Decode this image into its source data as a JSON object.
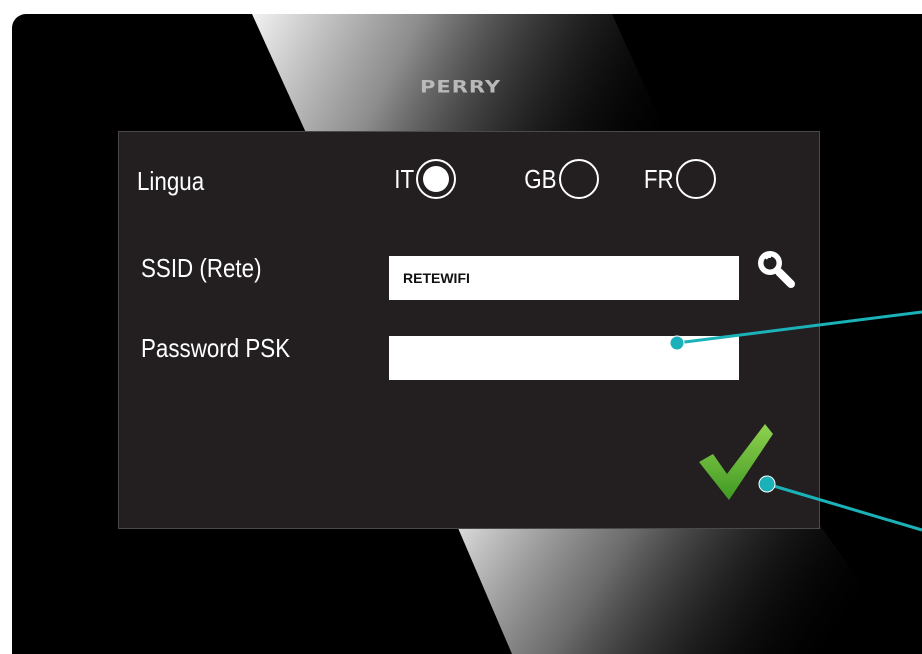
{
  "brand": {
    "logo_text": "PERRY"
  },
  "settings": {
    "language": {
      "label": "Lingua",
      "options": [
        {
          "code": "IT",
          "selected": true
        },
        {
          "code": "GB",
          "selected": false
        },
        {
          "code": "FR",
          "selected": false
        }
      ]
    },
    "ssid": {
      "label": "SSID (Rete)",
      "value": "RETEWIFI"
    },
    "password": {
      "label": "Password PSK",
      "value": ""
    }
  },
  "icons": {
    "search": "magnifier-icon",
    "confirm": "checkmark-icon"
  },
  "colors": {
    "device_bg": "#000000",
    "panel_bg": "#231f20",
    "callout": "#1ab2b8",
    "check_green": "#5cb82e"
  }
}
